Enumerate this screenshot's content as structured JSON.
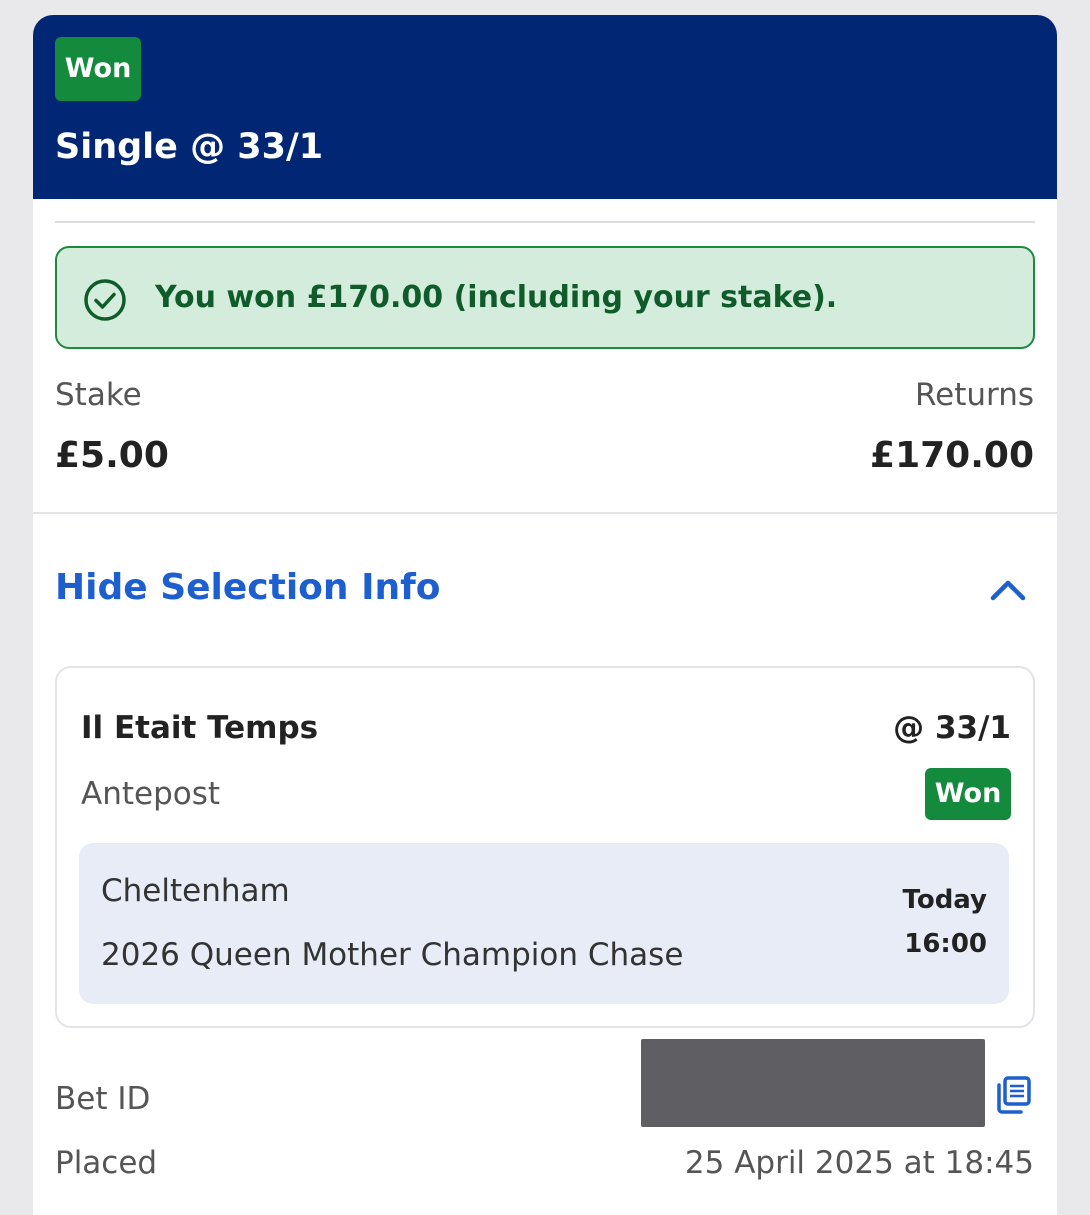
{
  "header": {
    "status_badge": "Won",
    "bet_type": "Single @ 33/1",
    "background_color": "#002674"
  },
  "result_banner": {
    "icon": "check-circle-icon",
    "text": "You won £170.00 (including your stake)."
  },
  "summary": {
    "stake_label": "Stake",
    "stake_value": "£5.00",
    "returns_label": "Returns",
    "returns_value": "£170.00"
  },
  "selection_toggle": {
    "label": "Hide Selection Info",
    "icon": "chevron-up-icon"
  },
  "selection": {
    "name": "Il Etait Temps",
    "odds": "@ 33/1",
    "market": "Antepost",
    "status": "Won",
    "event": {
      "venue": "Cheltenham",
      "race": "2026 Queen Mother Champion Chase",
      "day": "Today",
      "time": "16:00"
    }
  },
  "details": {
    "bet_id_label": "Bet ID",
    "copy_icon": "copy-icon",
    "placed_label": "Placed",
    "placed_value": "25 April 2025 at 18:45"
  },
  "colors": {
    "won_green": "#138a3c",
    "link_blue": "#1e5fd0",
    "banner_bg": "#d3ecdc"
  }
}
